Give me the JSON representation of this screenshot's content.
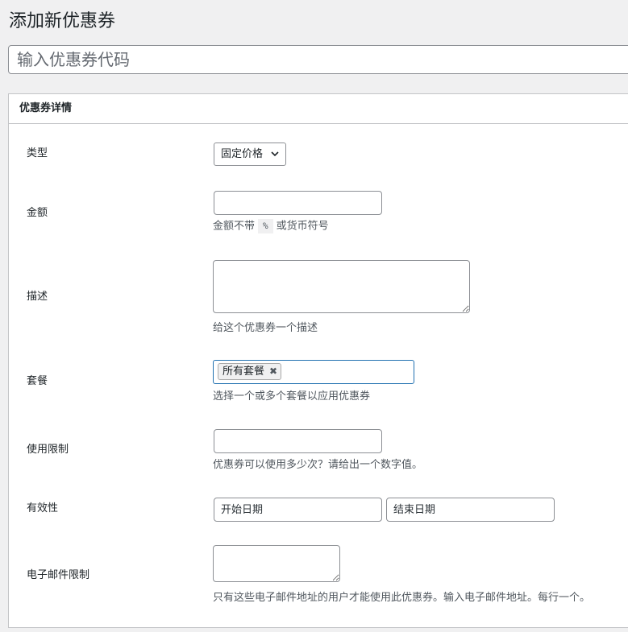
{
  "page": {
    "title": "添加新优惠券",
    "code_placeholder": "输入优惠券代码"
  },
  "postbox": {
    "title": "优惠券详情"
  },
  "fields": {
    "type": {
      "label": "类型",
      "selected": "固定价格",
      "icon": "chevron-down-icon"
    },
    "amount": {
      "label": "金额",
      "value": "",
      "desc_before": "金额不带",
      "desc_code": "%",
      "desc_after": "或货币符号"
    },
    "description": {
      "label": "描述",
      "value": "",
      "desc": "给这个优惠券一个描述"
    },
    "packages": {
      "label": "套餐",
      "tags": [
        "所有套餐"
      ],
      "remove_icon": "close-icon",
      "remove_glyph": "✖",
      "desc": "选择一个或多个套餐以应用优惠券"
    },
    "usage_limit": {
      "label": "使用限制",
      "value": "",
      "desc": "优惠券可以使用多少次？请给出一个数字值。"
    },
    "validity": {
      "label": "有效性",
      "start_placeholder": "开始日期",
      "end_placeholder": "结束日期"
    },
    "email_restriction": {
      "label": "电子邮件限制",
      "value": "",
      "desc": "只有这些电子邮件地址的用户才能使用此优惠券。输入电子邮件地址。每行一个。"
    }
  }
}
